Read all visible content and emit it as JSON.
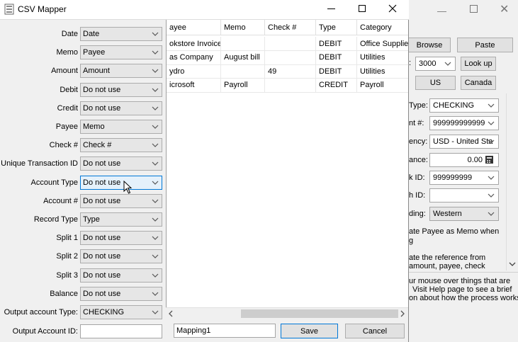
{
  "bg_window": {
    "buttons": {
      "browse": "Browse",
      "paste": "Paste",
      "look_up": "Look up",
      "us": "US",
      "canada": "Canada"
    },
    "zip_select": "3000",
    "type_label": "Type:",
    "type_value": "CHECKING",
    "acct_label": "nt #:",
    "acct_value": "999999999999",
    "currency_label": "ency:",
    "currency_value": "USD - United Sta",
    "balance_label": "ance:",
    "balance_value": "0.00",
    "bankid_label": "k ID:",
    "bankid_value": "999999999",
    "branch_label": "h ID:",
    "branch_value": "",
    "encoding_label": "ding:",
    "encoding_value": "Western",
    "opt1_line1": "ate Payee as Memo when",
    "opt1_line2": "g",
    "opt2_line1": "ate the reference from",
    "opt2_line2": "amount, payee, check",
    "help_line1": "ur mouse over things that are",
    "help_line2": "Visit Help page to see a brief",
    "help_line3": "on about how the process works"
  },
  "window": {
    "title": "CSV Mapper",
    "fields": [
      {
        "label": "Date",
        "value": "Date"
      },
      {
        "label": "Memo",
        "value": "Payee"
      },
      {
        "label": "Amount",
        "value": "Amount"
      },
      {
        "label": "Debit",
        "value": "Do not use"
      },
      {
        "label": "Credit",
        "value": "Do not use"
      },
      {
        "label": "Payee",
        "value": "Memo"
      },
      {
        "label": "Check #",
        "value": "Check #"
      },
      {
        "label": "Unique Transaction ID",
        "value": "Do not use"
      },
      {
        "label": "Account Type",
        "value": "Do not use"
      },
      {
        "label": "Account #",
        "value": "Do not use"
      },
      {
        "label": "Record Type",
        "value": "Type"
      },
      {
        "label": "Split 1",
        "value": "Do not use"
      },
      {
        "label": "Split 2",
        "value": "Do not use"
      },
      {
        "label": "Split 3",
        "value": "Do not use"
      },
      {
        "label": "Balance",
        "value": "Do not use"
      },
      {
        "label": "Output account Type:",
        "value": "CHECKING"
      }
    ],
    "output_account_id_label": "Output Account ID:",
    "output_account_id_value": "",
    "grid": {
      "headers": [
        "ayee",
        "Memo",
        "Check #",
        "Type",
        "Category"
      ],
      "rows": [
        [
          "okstore Invoice",
          "",
          "",
          "DEBIT",
          "Office Supplies"
        ],
        [
          "as Company",
          "August bill",
          "",
          "DEBIT",
          "Utilities"
        ],
        [
          "ydro",
          "",
          "49",
          "DEBIT",
          "Utilities"
        ],
        [
          "icrosoft",
          "Payroll",
          "",
          "CREDIT",
          "Payroll"
        ]
      ]
    },
    "mapping_name": "Mapping1",
    "save_label": "Save",
    "cancel_label": "Cancel"
  }
}
